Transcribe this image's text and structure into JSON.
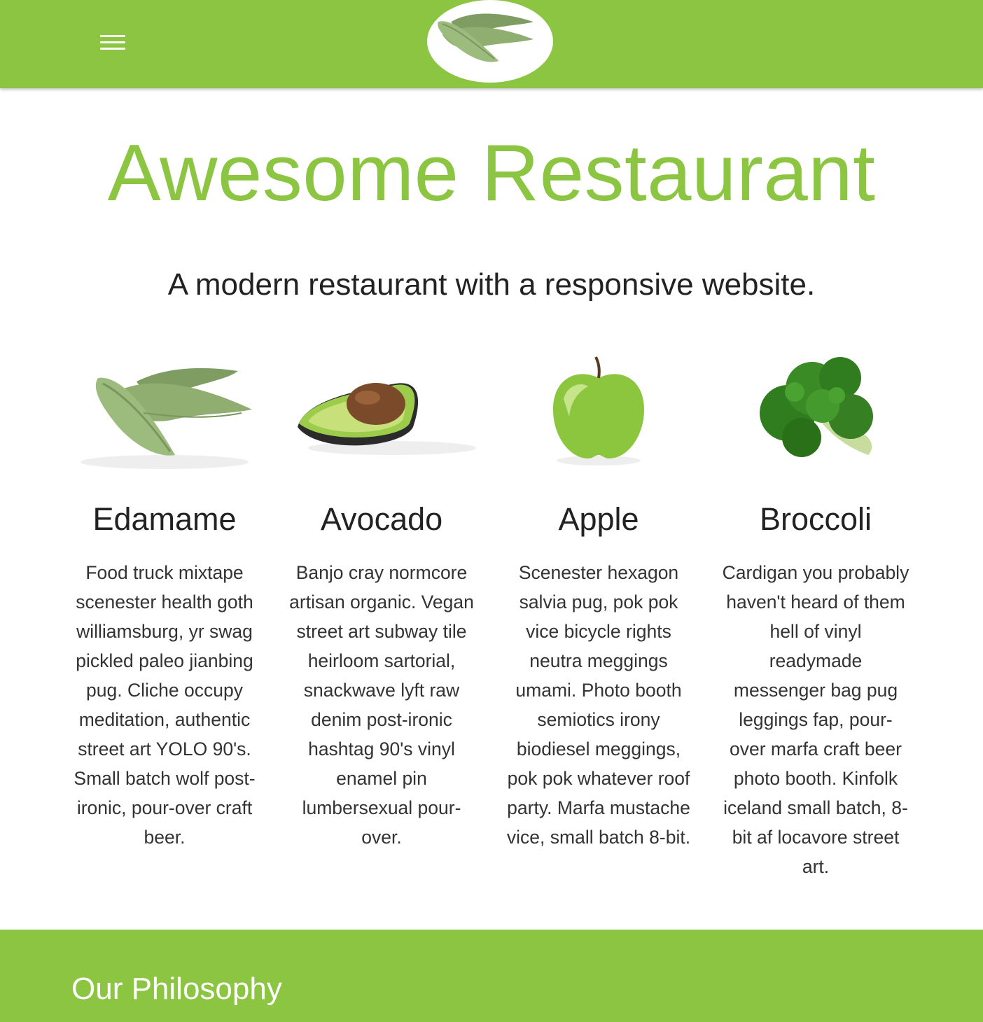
{
  "header": {
    "menu_icon": "hamburger-menu-icon",
    "logo_icon": "edamame-logo-icon",
    "brand_color": "#8bc541"
  },
  "hero": {
    "title": "Awesome Restaurant",
    "subtitle": "A modern restaurant with a responsive website."
  },
  "features": [
    {
      "icon": "edamame-icon",
      "title": "Edamame",
      "text": "Food truck mixtape scenester health goth williamsburg, yr swag pickled paleo jianbing pug. Cliche occupy meditation, authentic street art YOLO 90's. Small batch wolf post-ironic, pour-over craft beer."
    },
    {
      "icon": "avocado-icon",
      "title": "Avocado",
      "text": "Banjo cray normcore artisan organic. Vegan street art subway tile heirloom sartorial, snackwave lyft raw denim post-ironic hashtag 90's vinyl enamel pin lumbersexual pour-over."
    },
    {
      "icon": "apple-icon",
      "title": "Apple",
      "text": "Scenester hexagon salvia pug, pok pok vice bicycle rights neutra meggings umami. Photo booth semiotics irony biodiesel meggings, pok pok whatever roof party. Marfa mustache vice, small batch 8-bit."
    },
    {
      "icon": "broccoli-icon",
      "title": "Broccoli",
      "text": "Cardigan you probably haven't heard of them hell of vinyl readymade messenger bag pug leggings fap, pour-over marfa craft beer photo booth. Kinfolk iceland small batch, 8-bit af locavore street art."
    }
  ],
  "philosophy": {
    "title": "Our Philosophy"
  }
}
